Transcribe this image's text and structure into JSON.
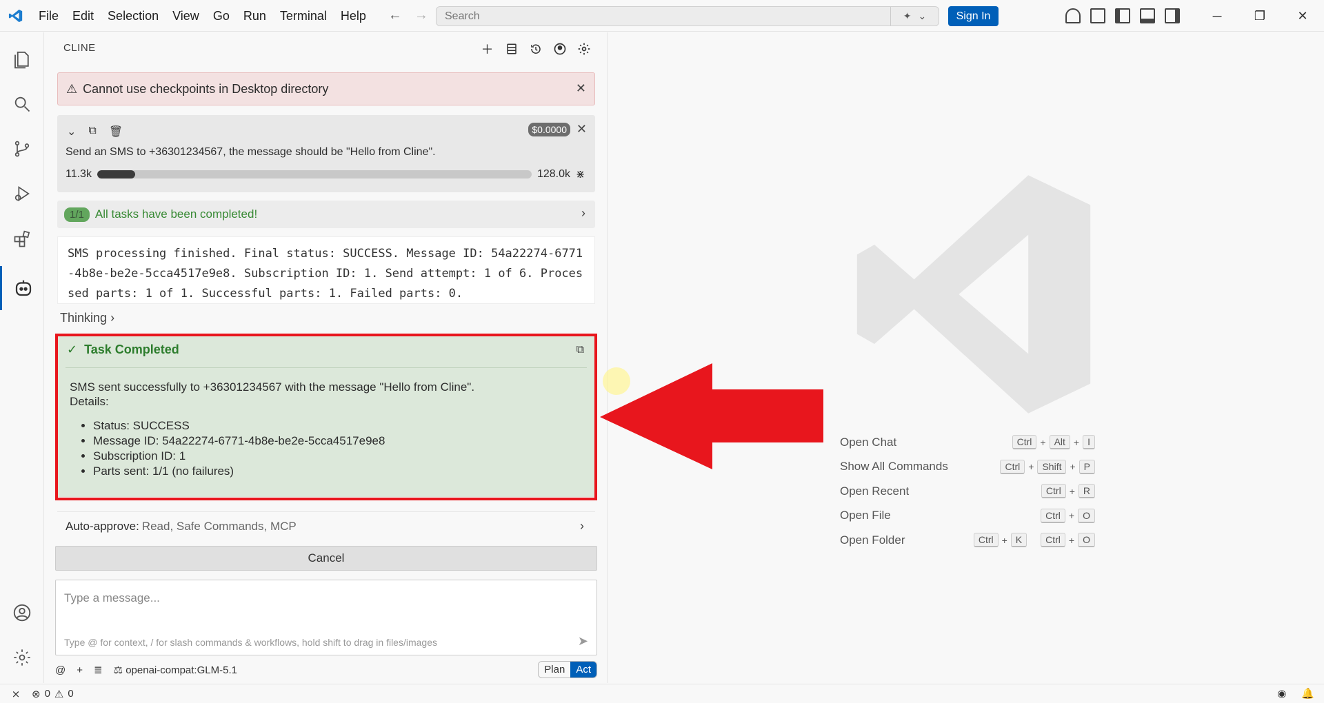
{
  "titlebar": {
    "menu": [
      "File",
      "Edit",
      "Selection",
      "View",
      "Go",
      "Run",
      "Terminal",
      "Help"
    ],
    "search_placeholder": "Search",
    "sign_in": "Sign In"
  },
  "sidebar": {
    "title": "CLINE",
    "warning": "Cannot use checkpoints in Desktop directory",
    "task": {
      "cost": "$0.0000",
      "text": "Send an SMS to +36301234567, the message should be \"Hello from Cline\".",
      "ctx_used": "11.3k",
      "ctx_total": "128.0k",
      "ctx_fraction": 0.088
    },
    "todo": {
      "badge": "1/1",
      "label": "All tasks have been completed!"
    },
    "output": "SMS processing finished. Final status: SUCCESS. Message ID: 54a22274-6771-4b8e-be2e-5cca4517e9e8. Subscription ID: 1. Send attempt: 1 of 6. Processed parts: 1 of 1. Successful parts: 1. Failed parts: 0.",
    "thinking": "Thinking",
    "completed": {
      "title": "Task Completed",
      "line1": "SMS sent successfully to +36301234567 with the message \"Hello from Cline\".",
      "line2": "Details:",
      "details": [
        "Status: SUCCESS",
        "Message ID: 54a22274-6771-4b8e-be2e-5cca4517e9e8",
        "Subscription ID: 1",
        "Parts sent: 1/1 (no failures)"
      ]
    },
    "auto_approve_label": "Auto-approve:",
    "auto_approve_value": "Read, Safe Commands, MCP",
    "cancel": "Cancel",
    "message_placeholder": "Type a message...",
    "message_hint": "Type @ for context, / for slash commands & workflows, hold shift to drag in files/images",
    "model": "openai-compat:GLM-5.1",
    "plan": "Plan",
    "act": "Act"
  },
  "editor": {
    "shortcuts": [
      {
        "label": "Open Chat",
        "keys": [
          [
            "Ctrl",
            "Alt",
            "I"
          ]
        ]
      },
      {
        "label": "Show All Commands",
        "keys": [
          [
            "Ctrl",
            "Shift",
            "P"
          ]
        ]
      },
      {
        "label": "Open Recent",
        "keys": [
          [
            "Ctrl",
            "R"
          ]
        ]
      },
      {
        "label": "Open File",
        "keys": [
          [
            "Ctrl",
            "O"
          ]
        ]
      },
      {
        "label": "Open Folder",
        "keys": [
          [
            "Ctrl",
            "K"
          ],
          [
            "Ctrl",
            "O"
          ]
        ]
      }
    ]
  },
  "statusbar": {
    "errors": "0",
    "warnings": "0"
  },
  "colors": {
    "accent": "#005fb8",
    "success_green": "#388a34",
    "completed_bg": "#dce8da",
    "annotation_red": "#e8161d"
  }
}
